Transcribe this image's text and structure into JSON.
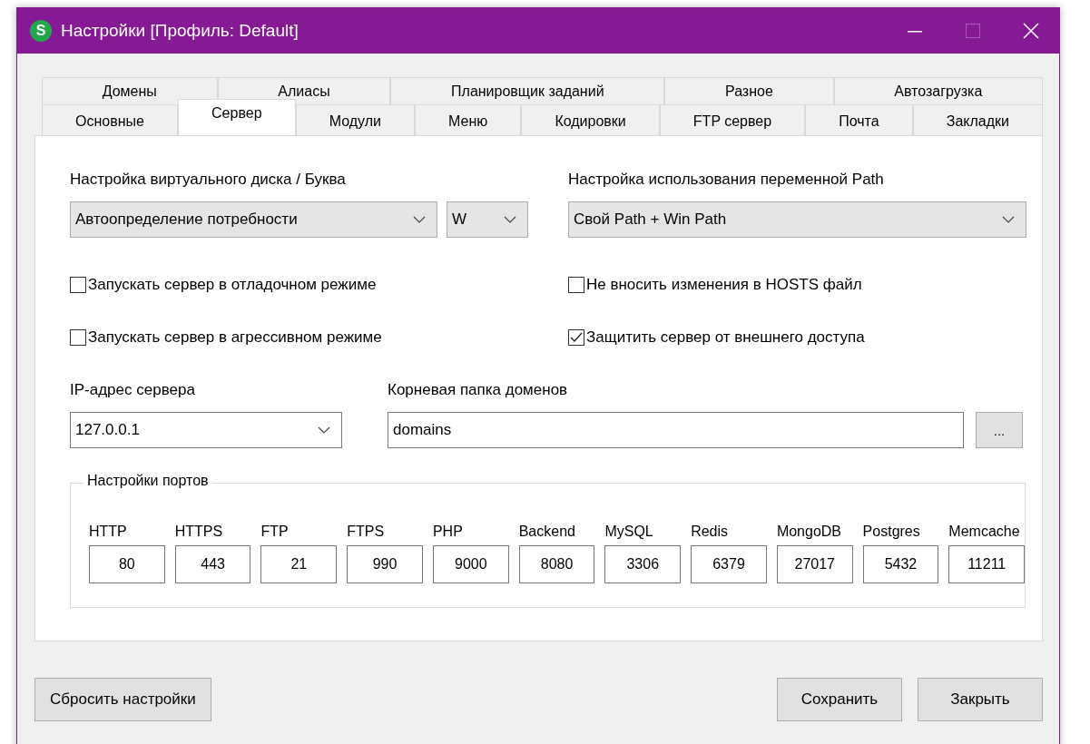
{
  "window": {
    "title": "Настройки [Профиль: Default]",
    "icon_letter": "S"
  },
  "tab_rows": [
    [
      {
        "label": "Домены",
        "selected": false
      },
      {
        "label": "Алиасы",
        "selected": false
      },
      {
        "label": "Планировщик заданий",
        "selected": false
      },
      {
        "label": "Разное",
        "selected": false
      },
      {
        "label": "Автозагрузка",
        "selected": false
      }
    ],
    [
      {
        "label": "Основные",
        "selected": false
      },
      {
        "label": "Сервер",
        "selected": true
      },
      {
        "label": "Модули",
        "selected": false
      },
      {
        "label": "Меню",
        "selected": false
      },
      {
        "label": "Кодировки",
        "selected": false
      },
      {
        "label": "FTP сервер",
        "selected": false
      },
      {
        "label": "Почта",
        "selected": false
      },
      {
        "label": "Закладки",
        "selected": false
      }
    ]
  ],
  "virtual_disk": {
    "label": "Настройка виртуального диска / Буква",
    "mode": "Автоопределение потребности",
    "letter": "W"
  },
  "path_setting": {
    "label": "Настройка использования переменной Path",
    "value": "Свой Path + Win Path"
  },
  "checkboxes_left": [
    {
      "label": "Запускать сервер в отладочном режиме",
      "checked": false
    },
    {
      "label": "Запускать сервер в агрессивном режиме",
      "checked": false
    }
  ],
  "checkboxes_right": [
    {
      "label": "Не вносить изменения в HOSTS файл",
      "checked": false
    },
    {
      "label": "Защитить сервер от внешнего доступа",
      "checked": true
    }
  ],
  "server_ip": {
    "label": "IP-адрес сервера",
    "value": "127.0.0.1"
  },
  "domains_root": {
    "label": "Корневая папка доменов",
    "value": "domains",
    "browse": "..."
  },
  "ports": {
    "title": "Настройки портов",
    "items": [
      {
        "name": "HTTP",
        "value": "80"
      },
      {
        "name": "HTTPS",
        "value": "443"
      },
      {
        "name": "FTP",
        "value": "21"
      },
      {
        "name": "FTPS",
        "value": "990"
      },
      {
        "name": "PHP",
        "value": "9000"
      },
      {
        "name": "Backend",
        "value": "8080"
      },
      {
        "name": "MySQL",
        "value": "3306"
      },
      {
        "name": "Redis",
        "value": "6379"
      },
      {
        "name": "MongoDB",
        "value": "27017"
      },
      {
        "name": "Postgres",
        "value": "5432"
      },
      {
        "name": "Memcache",
        "value": "11211"
      }
    ]
  },
  "buttons": {
    "reset": "Сбросить настройки",
    "save": "Сохранить",
    "close": "Закрыть"
  }
}
